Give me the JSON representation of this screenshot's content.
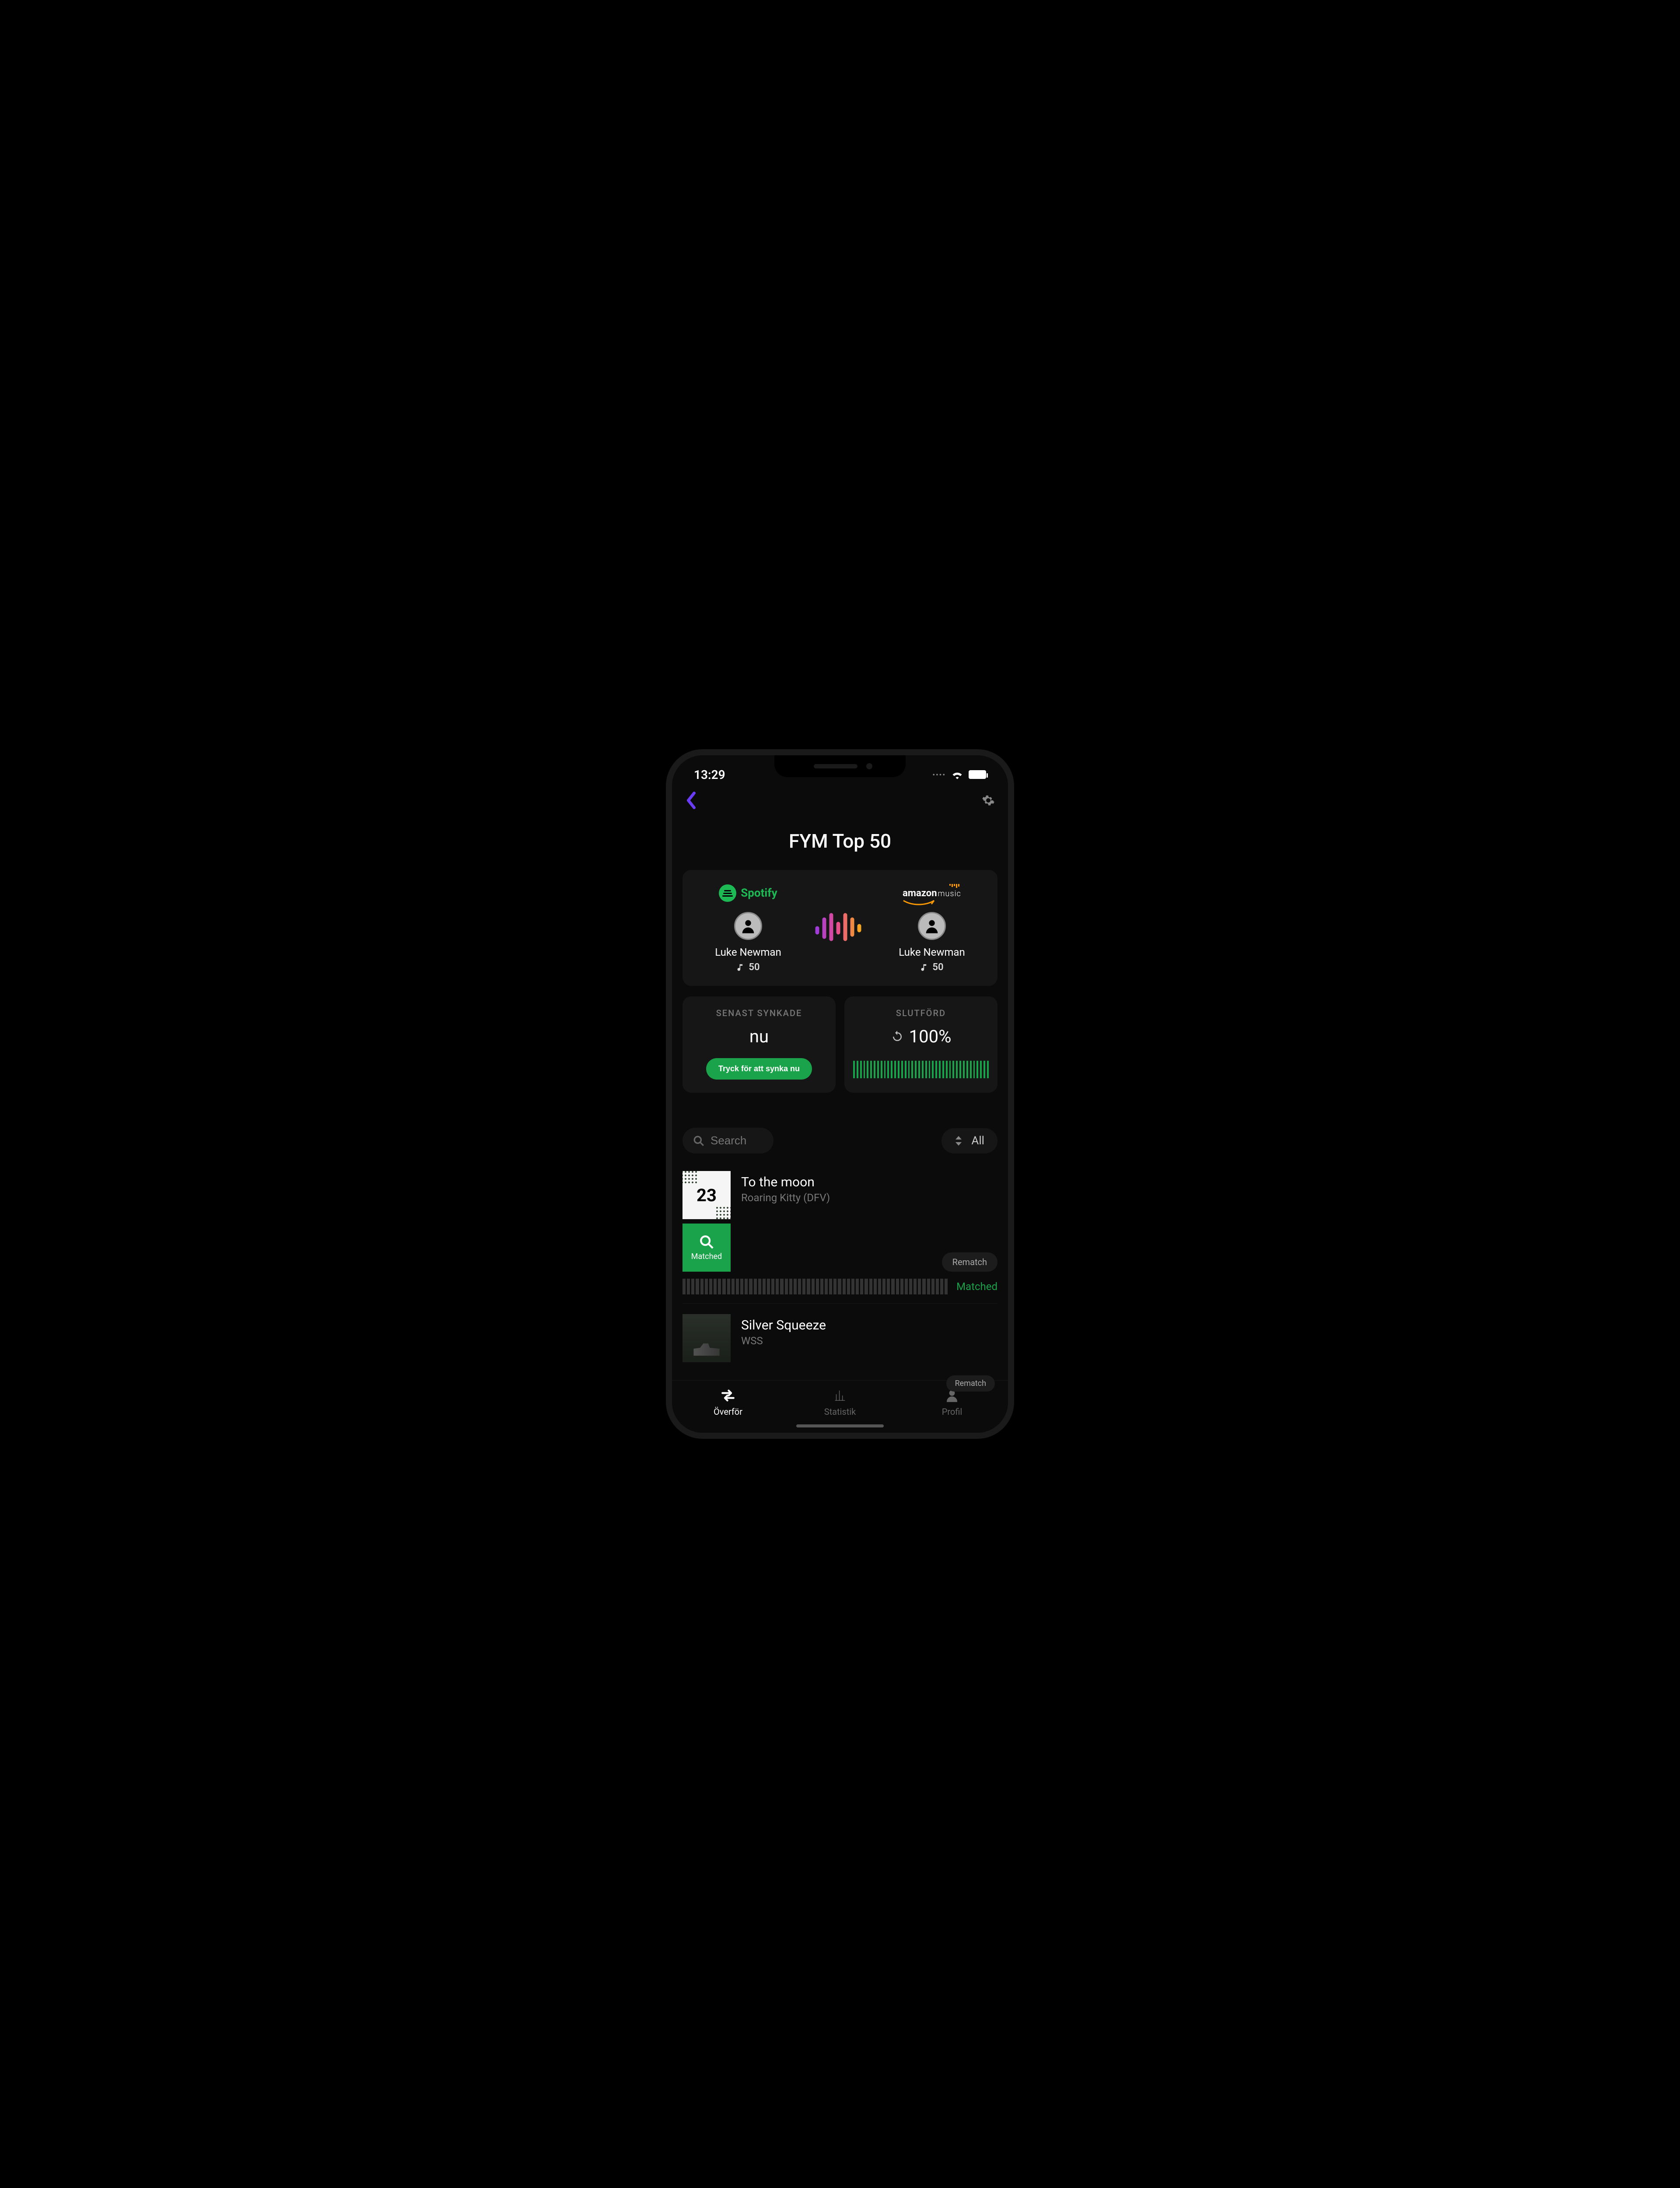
{
  "status": {
    "time": "13:29"
  },
  "page_title": "FYM Top 50",
  "services": {
    "source": {
      "brand": "Spotify",
      "user": "Luke Newman",
      "track_count": "50"
    },
    "target": {
      "brand_line1": "amazon",
      "brand_line2": "music",
      "user": "Luke Newman",
      "track_count": "50"
    }
  },
  "sync_card": {
    "label": "SENAST SYNKADE",
    "value": "nu",
    "button": "Tryck för att synka nu"
  },
  "complete_card": {
    "label": "SLUTFÖRD",
    "value": "100%"
  },
  "search": {
    "placeholder": "Search"
  },
  "filter": {
    "label": "All"
  },
  "tracks": [
    {
      "cover_text": "23",
      "title": "To the moon",
      "artist": "Roaring Kitty (DFV)",
      "rematch": "Rematch",
      "matched_box": "Matched",
      "status": "Matched"
    },
    {
      "title": "Silver Squeeze",
      "artist": "WSS",
      "rematch": "Rematch"
    }
  ],
  "tabs": {
    "transfer": "Överför",
    "stats": "Statistik",
    "profile": "Profil"
  }
}
